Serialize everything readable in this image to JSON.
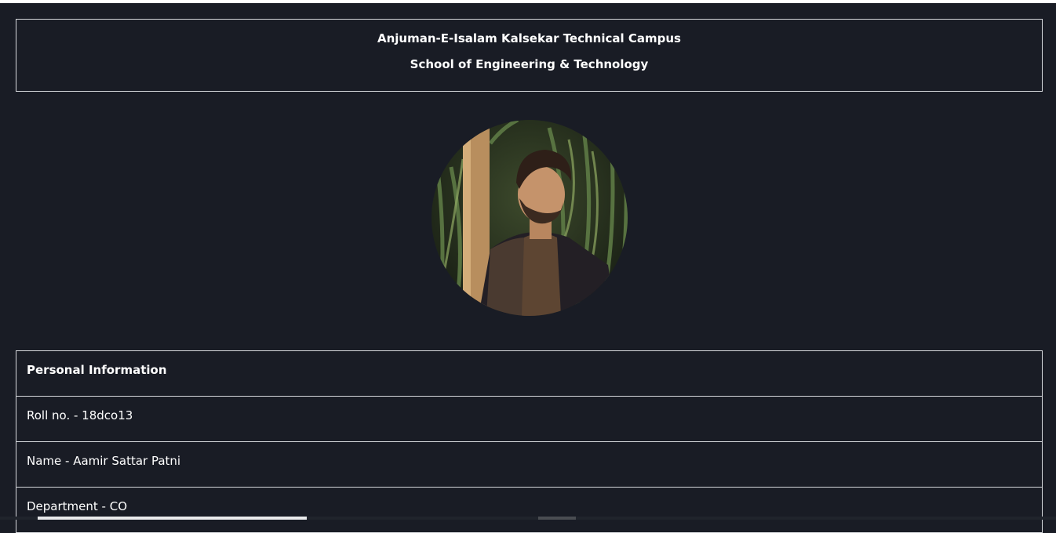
{
  "header": {
    "line1": "Anjuman-E-Isalam Kalsekar Technical Campus",
    "line2": "School of Engineering & Technology"
  },
  "profile": {
    "photo_icon": "profile-photo"
  },
  "info": {
    "title": "Personal Information",
    "rows": [
      "Roll no. - 18dco13",
      "Name - Aamir Sattar Patni",
      "Department - CO"
    ]
  },
  "colors": {
    "background": "#191c25",
    "border": "#d7d9dd",
    "text": "#ffffff"
  }
}
